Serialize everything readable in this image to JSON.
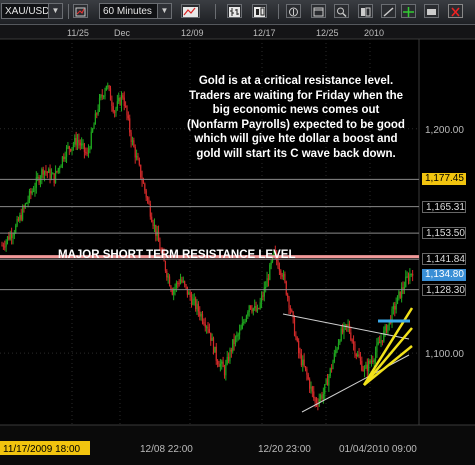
{
  "toolbar": {
    "symbol": "XAU/USD",
    "timeframe": "60 Minutes",
    "icons": [
      "symbol-dropdown",
      "timeframe-dropdown",
      "chart-type-icon",
      "indicators-icon",
      "bar-icon",
      "candle-icon",
      "scroll-icon",
      "window-icon",
      "zoom-icon",
      "layout-icon",
      "drawing-icon",
      "crosshair-icon",
      "settings-icon",
      "close-icon"
    ]
  },
  "colors": {
    "bull": "#1fa81f",
    "bear": "#d42a2a",
    "resistance": "#f19999",
    "trend_yellow": "#f2e21a",
    "cyan": "#3aa7e8",
    "level_box_yellow": "#f1c40f",
    "current_price_box": "#3a8fd6"
  },
  "chart_data": {
    "type": "candlestick",
    "symbol": "XAU/USD",
    "timeframe": "60 Minutes",
    "x_tick_labels_top": [
      "11/25",
      "Dec",
      "12/09",
      "12/17",
      "12/25",
      "2010"
    ],
    "x_tick_labels_bottom": [
      "11/17/2009 18:00",
      "12/08 22:00",
      "12/20 23:00",
      "01/04/2010 09:00"
    ],
    "y_tick_labels": [
      "1,200.00",
      "1,100.00"
    ],
    "y_grid_values": [
      1200,
      1100
    ],
    "ylim": [
      1068,
      1240
    ],
    "price_levels": [
      {
        "label": "1,177.45",
        "value": 1177.45,
        "style": "yellow"
      },
      {
        "label": "1,165.31",
        "value": 1165.31,
        "style": "plain"
      },
      {
        "label": "1,153.50",
        "value": 1153.5,
        "style": "plain"
      },
      {
        "label": "1,141.84",
        "value": 1141.84,
        "style": "plain"
      },
      {
        "label": "1,134.80",
        "value": 1134.8,
        "style": "current"
      },
      {
        "label": "1,128.30",
        "value": 1128.3,
        "style": "plain"
      }
    ],
    "resistance_level": 1143,
    "resistance_label": "MAJOR SHORT TERM RESISTANCE LEVEL",
    "annotation": "Gold is at a critical resistance level. Traders are waiting for Friday when the big economic news comes out (Nonfarm Payrolls) expected to be good which will give hte dollar a boost and gold will start its C wave back down.",
    "price_path": [
      [
        0,
        1148
      ],
      [
        10,
        1156
      ],
      [
        20,
        1170
      ],
      [
        30,
        1182
      ],
      [
        38,
        1178
      ],
      [
        46,
        1190
      ],
      [
        55,
        1195
      ],
      [
        62,
        1188
      ],
      [
        70,
        1210
      ],
      [
        76,
        1220
      ],
      [
        82,
        1208
      ],
      [
        88,
        1215
      ],
      [
        94,
        1196
      ],
      [
        100,
        1182
      ],
      [
        106,
        1168
      ],
      [
        112,
        1154
      ],
      [
        118,
        1140
      ],
      [
        124,
        1128
      ],
      [
        130,
        1133
      ],
      [
        136,
        1126
      ],
      [
        142,
        1120
      ],
      [
        150,
        1112
      ],
      [
        156,
        1098
      ],
      [
        162,
        1092
      ],
      [
        168,
        1104
      ],
      [
        174,
        1110
      ],
      [
        180,
        1122
      ],
      [
        186,
        1118
      ],
      [
        192,
        1130
      ],
      [
        198,
        1144
      ],
      [
        204,
        1136
      ],
      [
        210,
        1120
      ],
      [
        216,
        1100
      ],
      [
        222,
        1090
      ],
      [
        228,
        1078
      ],
      [
        234,
        1082
      ],
      [
        240,
        1094
      ],
      [
        246,
        1108
      ],
      [
        252,
        1112
      ],
      [
        258,
        1100
      ],
      [
        264,
        1092
      ],
      [
        270,
        1098
      ],
      [
        276,
        1106
      ],
      [
        282,
        1114
      ],
      [
        288,
        1124
      ],
      [
        294,
        1132
      ],
      [
        300,
        1138
      ]
    ]
  }
}
